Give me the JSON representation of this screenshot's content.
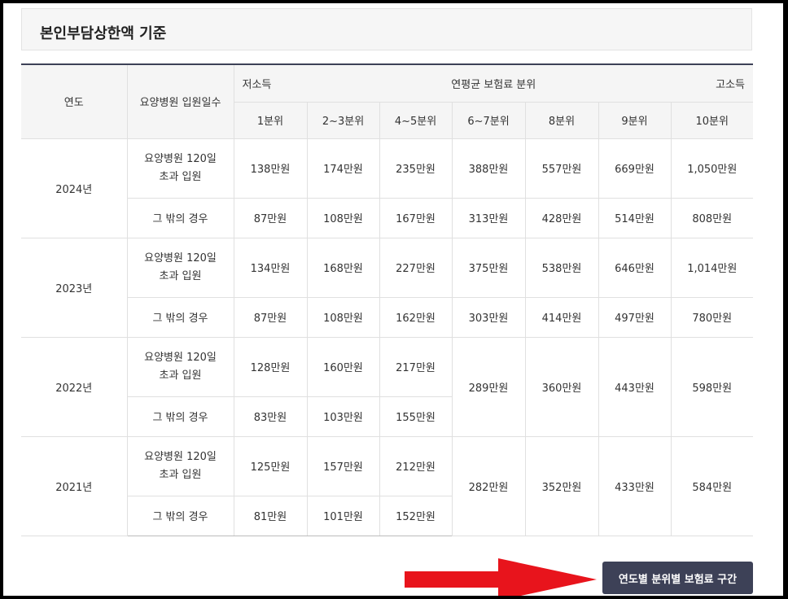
{
  "section_title": "본인부담상한액 기준",
  "header": {
    "year_label": "연도",
    "days_label": "요양병원 입원일수",
    "low_income": "저소득",
    "band_label": "연평균 보험료 분위",
    "high_income": "고소득",
    "deciles": [
      "1분위",
      "2~3분위",
      "4~5분위",
      "6~7분위",
      "8분위",
      "9분위",
      "10분위"
    ]
  },
  "conditions": {
    "over_120_line1": "요양병원 120일",
    "over_120_line2": "초과 입원",
    "other": "그 밖의 경우"
  },
  "years": [
    {
      "year": "2024년",
      "over_120": [
        "138만원",
        "174만원",
        "235만원",
        "388만원",
        "557만원",
        "669만원",
        "1,050만원"
      ],
      "other": [
        "87만원",
        "108만원",
        "167만원",
        "313만원",
        "428만원",
        "514만원",
        "808만원"
      ]
    },
    {
      "year": "2023년",
      "over_120": [
        "134만원",
        "168만원",
        "227만원",
        "375만원",
        "538만원",
        "646만원",
        "1,014만원"
      ],
      "other": [
        "87만원",
        "108만원",
        "162만원",
        "303만원",
        "414만원",
        "497만원",
        "780만원"
      ]
    },
    {
      "year": "2022년",
      "over_120": [
        "128만원",
        "160만원",
        "217만원"
      ],
      "other": [
        "83만원",
        "103만원",
        "155만원"
      ],
      "shared": [
        "289만원",
        "360만원",
        "443만원",
        "598만원"
      ]
    },
    {
      "year": "2021년",
      "over_120": [
        "125만원",
        "157만원",
        "212만원"
      ],
      "other": [
        "81만원",
        "101만원",
        "152만원"
      ],
      "shared": [
        "282만원",
        "352만원",
        "433만원",
        "584만원"
      ]
    }
  ],
  "footer_button": "연도별 분위별 보험료 구간",
  "arrow_color": "#e8141c",
  "accent_color": "#3d4157"
}
